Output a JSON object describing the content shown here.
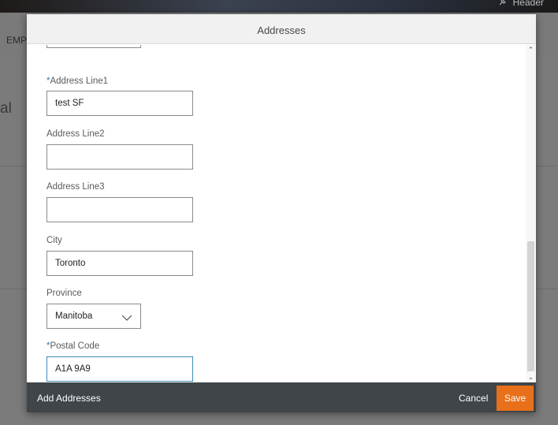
{
  "background": {
    "header_right": "Header",
    "tab_label": "EMPL",
    "side_text": "al"
  },
  "dialog": {
    "title": "Addresses",
    "fields": {
      "address_line1": {
        "label": "Address Line1",
        "required_mark": "*",
        "value": "test SF"
      },
      "address_line2": {
        "label": "Address Line2",
        "value": ""
      },
      "address_line3": {
        "label": "Address Line3",
        "value": ""
      },
      "city": {
        "label": "City",
        "value": "Toronto"
      },
      "province": {
        "label": "Province",
        "value": "Manitoba"
      },
      "postal_code": {
        "label": "Postal Code",
        "required_mark": "*",
        "value": "A1A 9A9"
      }
    },
    "scrollbar": {
      "up_glyph": "⌃",
      "down_glyph": "⌄"
    },
    "footer": {
      "left_label": "Add Addresses",
      "cancel_label": "Cancel",
      "save_label": "Save"
    }
  },
  "colors": {
    "save_button": "#e8701a",
    "footer_bg": "#3f4549",
    "required_mark": "#2a7bbf",
    "focused_border": "#3b8bb8"
  },
  "icons": {
    "province_dropdown": "chevron-down-icon",
    "header_pin": "pin-icon"
  }
}
